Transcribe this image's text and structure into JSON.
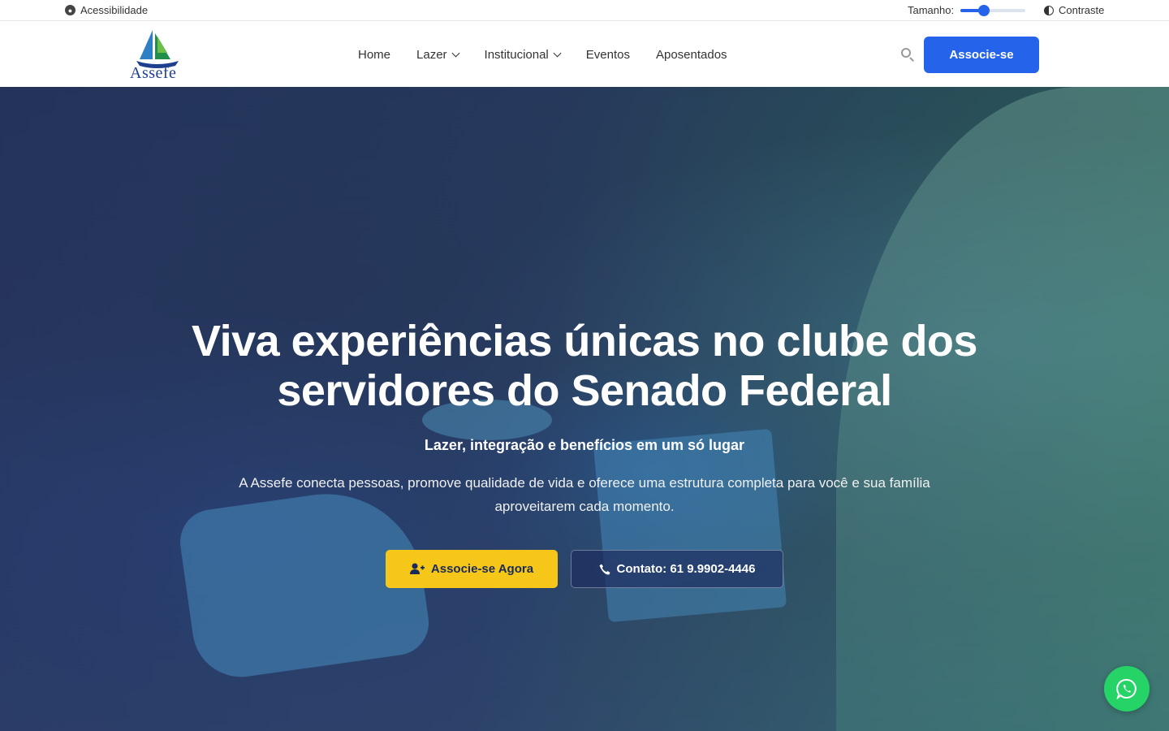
{
  "topbar": {
    "accessibility_label": "Acessibilidade",
    "size_label": "Tamanho:",
    "size_level": 0.36,
    "contrast_label": "Contraste"
  },
  "header": {
    "logo_text": "Assefe",
    "nav": [
      {
        "label": "Home",
        "has_dropdown": false
      },
      {
        "label": "Lazer",
        "has_dropdown": true
      },
      {
        "label": "Institucional",
        "has_dropdown": true
      },
      {
        "label": "Eventos",
        "has_dropdown": false
      },
      {
        "label": "Aposentados",
        "has_dropdown": false
      }
    ],
    "cta_label": "Associe-se"
  },
  "hero": {
    "title": "Viva experiências únicas no clube dos servidores do Senado Federal",
    "subtitle": "Lazer, integração e benefícios em um só lugar",
    "description": "A Assefe conecta pessoas, promove qualidade de vida e oferece uma estrutura completa para você e sua família aproveitarem cada momento.",
    "primary_button": "Associe-se Agora",
    "secondary_button": "Contato: 61 9.9902-4446"
  },
  "colors": {
    "brand_blue": "#2563eb",
    "accent_yellow": "#f6c619",
    "whatsapp_green": "#25d366"
  },
  "icons": [
    "accessibility-icon",
    "contrast-icon",
    "search-icon",
    "chevron-down-icon",
    "user-plus-icon",
    "phone-icon",
    "whatsapp-icon"
  ]
}
